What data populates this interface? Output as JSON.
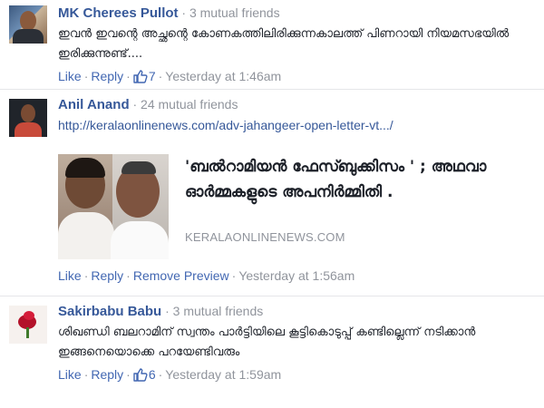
{
  "comments": [
    {
      "author": "MK Cherees Pullot",
      "mutual": " · 3 mutual friends",
      "text": "ഇവൻ ഇവന്റെ അച്ഛന്റെ കോണകത്തിലിരിക്കുന്നകാലത്ത് പിണറായി നിയമസഭയിൽ ഇരിക്കുന്നുണ്ട്....",
      "like_label": "Like",
      "reply_label": "Reply",
      "like_count": "7",
      "timestamp": "Yesterday at 1:46am"
    },
    {
      "author": "Anil Anand",
      "mutual": " · 24 mutual friends",
      "link": "http://keralaonlinenews.com/adv-jahangeer-open-letter-vt.../",
      "preview": {
        "title": "'ബൽറാമിയൻ ഫേസ്ബുക്കിസം ' ; അഥവാ ഓർമ്മകളുടെ അപനിർമ്മിതി .",
        "domain": "KERALAONLINENEWS.COM"
      },
      "like_label": "Like",
      "reply_label": "Reply",
      "remove_preview_label": "Remove Preview",
      "timestamp": "Yesterday at 1:56am"
    },
    {
      "author": "Sakirbabu Babu",
      "mutual": " · 3 mutual friends",
      "text": "ശിഖണ്ഡി ബലറാമിന് സ്വന്തം പാർട്ടിയിലെ കൂട്ടികൊടുപ്പ് കണ്ടില്ലെന്ന് നടിക്കാൻ ഇങ്ങനെയൊക്കെ പറയേണ്ടിവരും",
      "like_label": "Like",
      "reply_label": "Reply",
      "like_count": "6",
      "timestamp": "Yesterday at 1:59am"
    }
  ],
  "separator": "·",
  "icons": {
    "like": "thumbs-up-icon"
  },
  "colors": {
    "link_blue": "#365899",
    "action_blue": "#4267b2",
    "meta_gray": "#90949c",
    "text": "#1d2129"
  }
}
